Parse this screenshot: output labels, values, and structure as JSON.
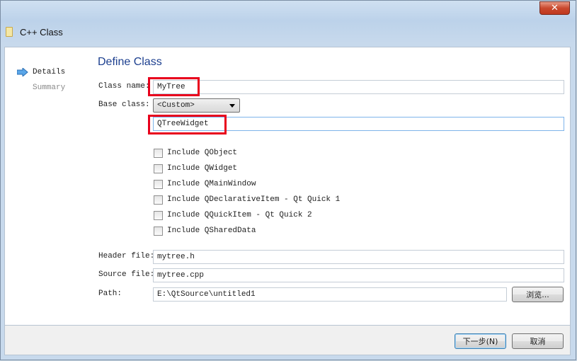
{
  "window": {
    "title": "C++ Class"
  },
  "nav": {
    "items": [
      {
        "label": "Details"
      },
      {
        "label": "Summary"
      }
    ]
  },
  "page": {
    "title": "Define Class"
  },
  "form": {
    "class_name_label": "Class name:",
    "class_name_value": "MyTree",
    "base_class_label": "Base class:",
    "base_class_selected": "<Custom>",
    "custom_base_value": "QTreeWidget",
    "includes": [
      {
        "label": "Include QObject",
        "checked": false
      },
      {
        "label": "Include QWidget",
        "checked": false
      },
      {
        "label": "Include QMainWindow",
        "checked": false
      },
      {
        "label": "Include QDeclarativeItem - Qt Quick 1",
        "checked": false
      },
      {
        "label": "Include QQuickItem - Qt Quick 2",
        "checked": false
      },
      {
        "label": "Include QSharedData",
        "checked": false
      }
    ],
    "header_file_label": "Header file:",
    "header_file_value": "mytree.h",
    "source_file_label": "Source file:",
    "source_file_value": "mytree.cpp",
    "path_label": "Path:",
    "path_value": "E:\\QtSource\\untitled1",
    "browse_label": "浏览..."
  },
  "buttons": {
    "next": "下一步(N)",
    "cancel": "取消"
  },
  "colors": {
    "highlight": "#e8001c",
    "heading": "#1c3f8f",
    "nav_arrow": "#3b8fd9"
  }
}
